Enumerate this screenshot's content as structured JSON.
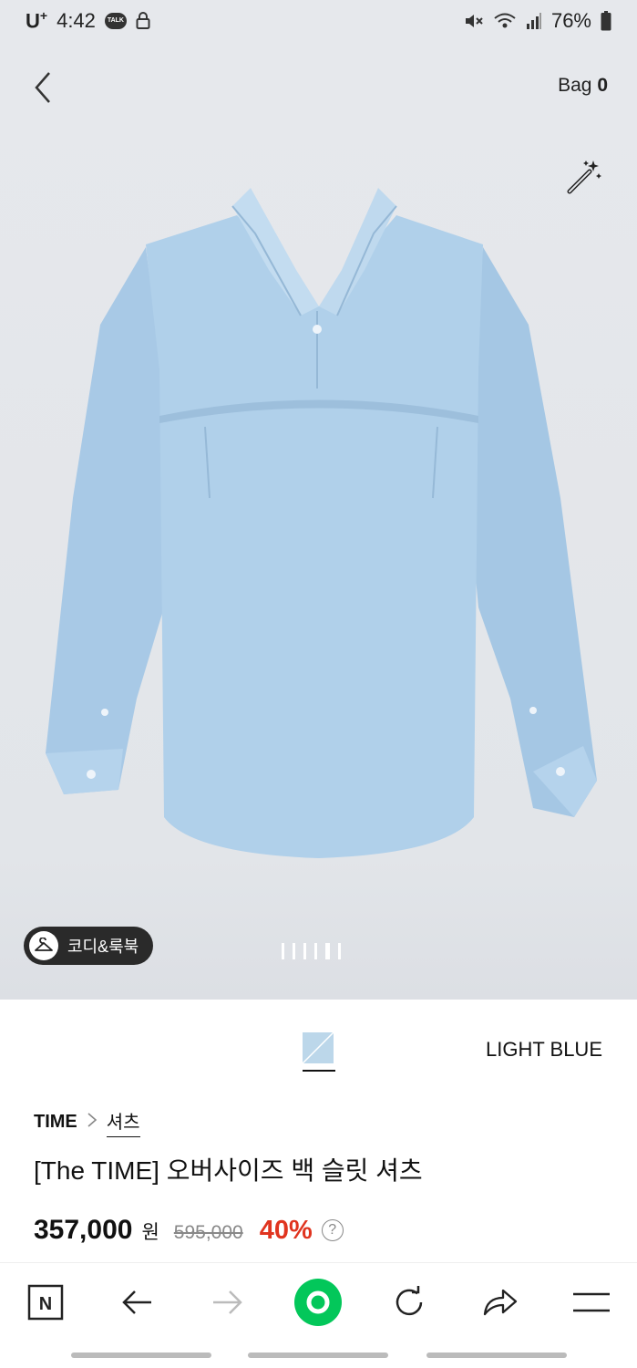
{
  "status_bar": {
    "carrier": "U",
    "carrier_sup": "+",
    "time": "4:42",
    "talk_badge": "TALK",
    "battery": "76%"
  },
  "header": {
    "bag_label": "Bag",
    "bag_count": "0"
  },
  "hero": {
    "codi_button": "코디&룩북",
    "image_count": 6,
    "active_image": 5
  },
  "color": {
    "name": "LIGHT BLUE",
    "swatch_color": "#bcd7ea"
  },
  "product": {
    "brand": "TIME",
    "separator": ">",
    "category": "셔츠",
    "title": "[The TIME] 오버사이즈 백 슬릿 셔츠",
    "price": "357,000",
    "currency": "원",
    "original_price": "595,000",
    "discount": "40%",
    "help": "?"
  },
  "bottom_nav": {
    "items": [
      "naver-home",
      "back",
      "forward",
      "green-home",
      "refresh",
      "share",
      "menu"
    ],
    "logo_letter": "N",
    "accent": "#03c75a"
  }
}
